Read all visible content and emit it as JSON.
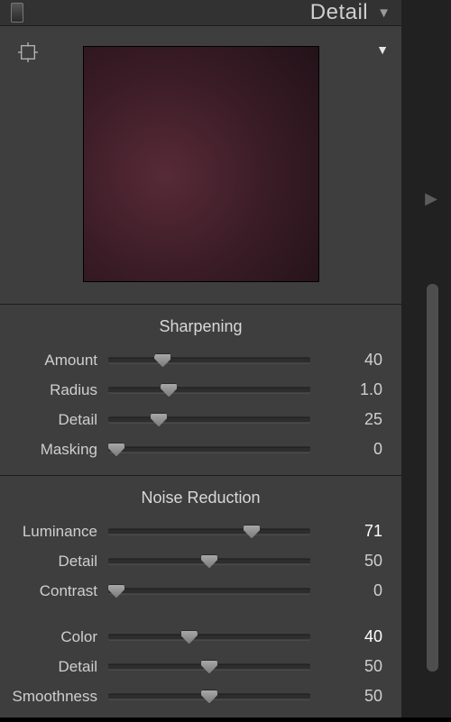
{
  "panel_title": "Detail",
  "sections": {
    "sharpening": {
      "title": "Sharpening",
      "amount": {
        "label": "Amount",
        "value": "40",
        "pct": 27
      },
      "radius": {
        "label": "Radius",
        "value": "1.0",
        "pct": 30
      },
      "detail": {
        "label": "Detail",
        "value": "25",
        "pct": 25
      },
      "masking": {
        "label": "Masking",
        "value": "0",
        "pct": 0
      }
    },
    "noise": {
      "title": "Noise Reduction",
      "luminance": {
        "label": "Luminance",
        "value": "71",
        "pct": 71,
        "strong": true
      },
      "ldetail": {
        "label": "Detail",
        "value": "50",
        "pct": 50
      },
      "contrast": {
        "label": "Contrast",
        "value": "0",
        "pct": 0
      },
      "color": {
        "label": "Color",
        "value": "40",
        "pct": 40,
        "strong": true
      },
      "cdetail": {
        "label": "Detail",
        "value": "50",
        "pct": 50
      },
      "smoothness": {
        "label": "Smoothness",
        "value": "50",
        "pct": 50
      }
    }
  }
}
